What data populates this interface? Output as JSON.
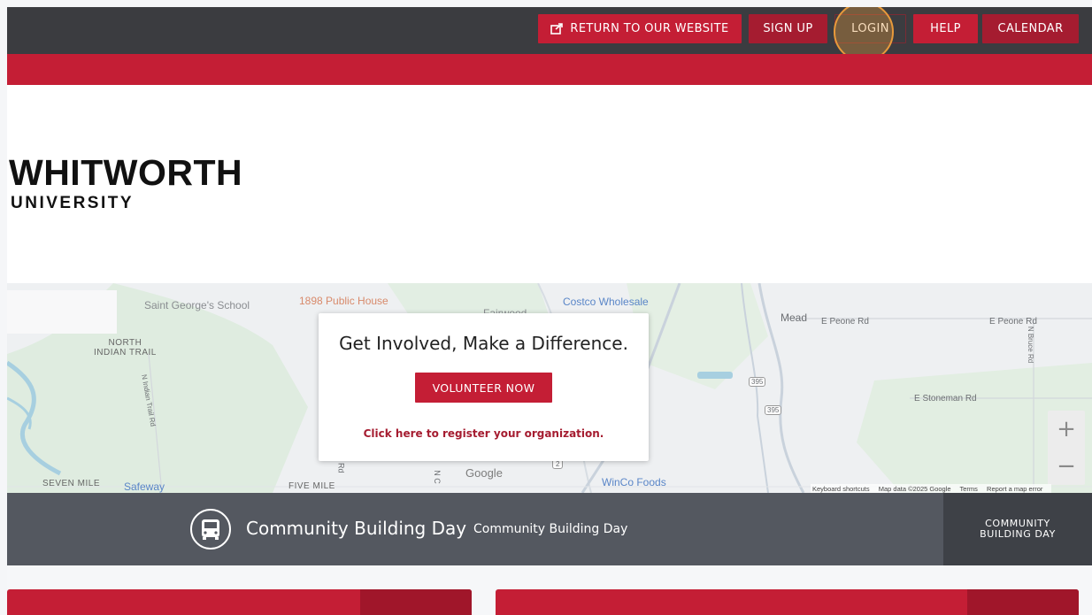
{
  "nav": {
    "return_label": "RETURN TO OUR WEBSITE",
    "signup_label": "SIGN UP",
    "login_label": "LOGIN",
    "help_label": "HELP",
    "calendar_label": "CALENDAR"
  },
  "logo": {
    "main": "WHITWORTH",
    "sub": "UNIVERSITY"
  },
  "map": {
    "labels": {
      "school": "Saint George's School",
      "pub": "1898 Public House",
      "fairwood": "Fairwood",
      "costco": "Costco Wholesale",
      "mead": "Mead",
      "peone1": "E Peone Rd",
      "peone2": "E Peone Rd",
      "north_indian": "NORTH\nINDIAN TRAIL",
      "indian_trail_rd": "N Indian Trail Rd",
      "stoneman": "E Stoneman Rd",
      "bruce": "N Bruce Rd",
      "seven_mile": "SEVEN MILE",
      "safeway": "Safeway",
      "five_mile": "FIVE MILE",
      "winco": "WinCo Foods",
      "google": "Google",
      "hwy1": "395",
      "hwy2": "395",
      "hwy3": "2",
      "road_e": "e Rd",
      "road_n": "N C"
    },
    "zoom_in": "+",
    "zoom_out": "−",
    "attribution": {
      "shortcuts": "Keyboard shortcuts",
      "data": "Map data ©2025 Google",
      "terms": "Terms",
      "report": "Report a map error"
    }
  },
  "card": {
    "title": "Get Involved, Make a Difference.",
    "button": "VOLUNTEER NOW",
    "link": "Click here to register your organization."
  },
  "community": {
    "title": "Community Building Day",
    "subtitle": "Community Building Day",
    "side_label": "COMMUNITY\nBUILDING DAY",
    "icon": "bus-icon"
  },
  "colors": {
    "brand_red": "#c41e35",
    "dark_red": "#a51c30",
    "topbar": "#3b3c40",
    "community_bar": "#545860"
  }
}
